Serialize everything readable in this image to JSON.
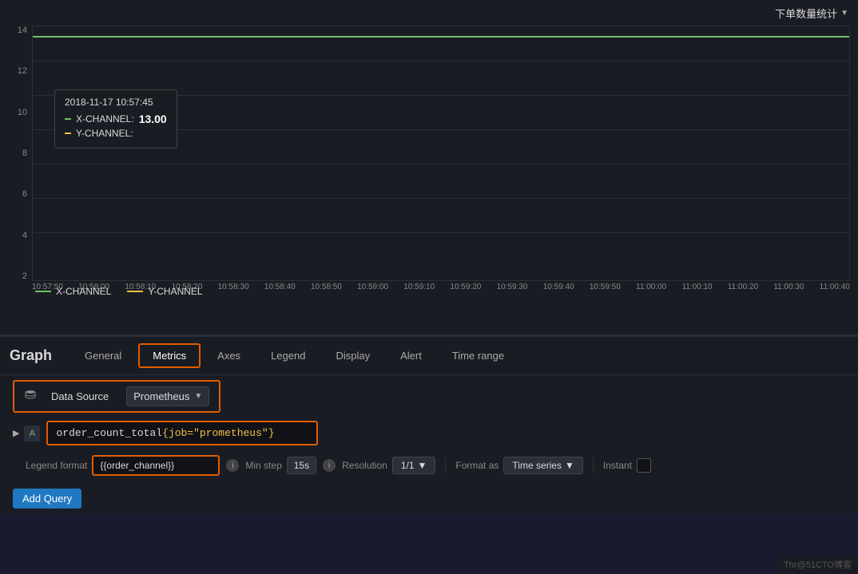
{
  "chart": {
    "title": "下单数量统计",
    "y_labels": [
      "2",
      "4",
      "6",
      "8",
      "10",
      "12",
      "14"
    ],
    "x_labels": [
      "10:57:50",
      "10:58:00",
      "10:58:10",
      "10:58:20",
      "10:58:30",
      "10:58:40",
      "10:58:50",
      "10:59:00",
      "10:59:10",
      "10:59:20",
      "10:59:30",
      "10:59:40",
      "10:59:50",
      "11:00:00",
      "11:00:10",
      "11:00:20",
      "11:00:30",
      "11:00:40"
    ],
    "tooltip": {
      "time": "2018-11-17 10:57:45",
      "x_channel_label": "X-CHANNEL:",
      "x_channel_value": "13.00",
      "y_channel_label": "Y-CHANNEL:",
      "y_channel_value": ""
    },
    "legend": {
      "x_channel": "X-CHANNEL",
      "y_channel": "Y-CHANNEL"
    }
  },
  "panel": {
    "title": "Graph",
    "tabs": [
      {
        "label": "General",
        "active": false
      },
      {
        "label": "Metrics",
        "active": true
      },
      {
        "label": "Axes",
        "active": false
      },
      {
        "label": "Legend",
        "active": false
      },
      {
        "label": "Display",
        "active": false
      },
      {
        "label": "Alert",
        "active": false
      },
      {
        "label": "Time range",
        "active": false
      }
    ]
  },
  "datasource": {
    "label": "Data Source",
    "value": "Prometheus",
    "dropdown_arrow": "▼"
  },
  "query": {
    "letter": "A",
    "text": "order_count_total{job=\"prometheus\"}"
  },
  "options": {
    "legend_format_label": "Legend format",
    "legend_format_value": "{{order_channel}}",
    "min_step_label": "Min step",
    "min_step_value": "15s",
    "resolution_label": "Resolution",
    "resolution_value": "1/1",
    "format_as_label": "Format as",
    "format_as_value": "Time series",
    "instant_label": "Instant"
  },
  "add_query_btn": "Add Query",
  "bottom_bar": "Thr@51CTO博客"
}
